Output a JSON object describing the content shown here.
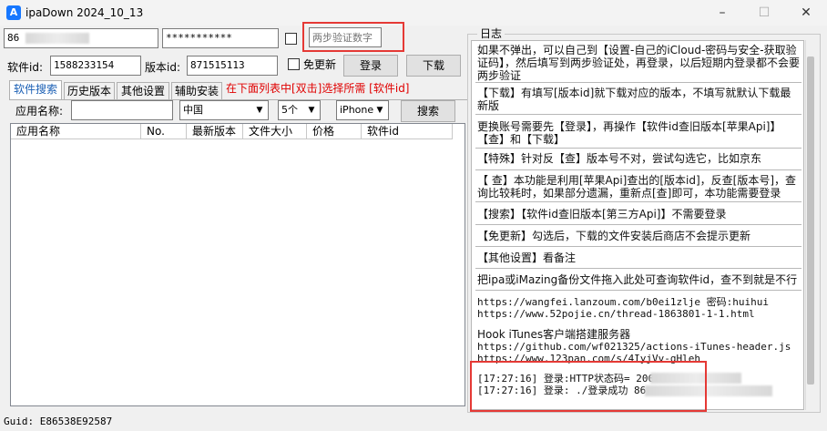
{
  "window": {
    "title": "ipaDown 2024_10_13"
  },
  "login": {
    "account_value": "86",
    "password_value": "***********",
    "twofactor_placeholder": "两步验证数字"
  },
  "row2": {
    "softid_label": "软件id:",
    "softid_value": "1588233154",
    "version_label": "版本id:",
    "version_value": "871515113",
    "noupdate_label": "免更新",
    "login_button": "登录",
    "download_button": "下载"
  },
  "tabs": [
    "软件搜索",
    "历史版本",
    "其他设置",
    "辅助安装"
  ],
  "tab_hint": "在下面列表中[双击]选择所需 [软件id]",
  "search": {
    "app_name_label": "应用名称:",
    "country": "中国",
    "count": "5个",
    "device": "iPhone",
    "search_button": "搜索"
  },
  "table": {
    "columns": [
      "应用名称",
      "No.",
      "最新版本",
      "文件大小",
      "价格",
      "软件id"
    ]
  },
  "log": {
    "group_label": "日志",
    "entries": [
      "如果不弹出，可以自己到【设置-自己的iCloud-密码与安全-获取验证码】，然后填写到两步验证处，再登录，以后短期内登录都不会要两步验证",
      "【下载】有填写[版本id]就下载对应的版本，不填写就默认下载最新版",
      "更换账号需要先【登录】，再操作【软件id查旧版本[苹果Api]】【查】和【下载】",
      "【特殊】针对反【查】版本号不对，尝试勾选它，比如京东",
      "【 查】本功能是利用[苹果Api]查出的[版本id]，反查[版本号]，查询比较耗时，如果部分遗漏，重新点[查]即可，本功能需要登录",
      "【搜索】【软件id查旧版本[第三方Api]】不需要登录",
      "【免更新】勾选后，下载的文件安装后商店不会提示更新",
      "【其他设置】看备注",
      "把ipa或iMazing备份文件拖入此处可查询软件id，查不到就是不行"
    ],
    "links": [
      "https://wangfei.lanzoum.com/b0ei1zlje 密码:huihui",
      "https://www.52pojie.cn/thread-1863801-1-1.html"
    ],
    "hook_title": "Hook iTunes客户端搭建服务器",
    "hook_links": [
      "https://github.com/wf021325/actions-iTunes-header.js",
      "https://www.123pan.com/s/4IyjVv-gHleh"
    ],
    "status_lines": [
      "[17:27:16] 登录:HTTP状态码= 200",
      "[17:27:16] 登录: ./登录成功 86"
    ]
  },
  "statusbar": {
    "guid": "Guid: E86538E92587"
  }
}
